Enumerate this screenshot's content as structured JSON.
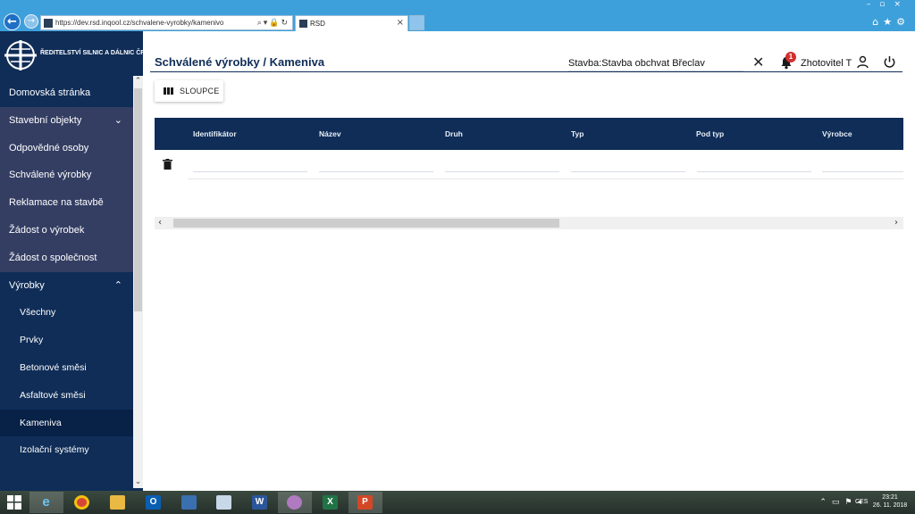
{
  "browser": {
    "url": "https://dev.rsd.inqool.cz/schvalene-vyrobky/kamenivo",
    "tab_title": "RSD"
  },
  "sidebar": {
    "logo_text": "ŘEDITELSTVÍ SILNIC A DÁLNIC ČR",
    "items": [
      {
        "label": "Domovská stránka"
      },
      {
        "label": "Stavební objekty",
        "chevron": "chevron-down-icon"
      },
      {
        "label": "Odpovědné osoby"
      },
      {
        "label": "Schválené výrobky"
      },
      {
        "label": "Reklamace na stavbě"
      },
      {
        "label": "Žádost o výrobek"
      },
      {
        "label": "Žádost o společnost"
      },
      {
        "label": "Výrobky",
        "chevron": "chevron-up-icon"
      },
      {
        "label": "Všechny"
      },
      {
        "label": "Prvky"
      },
      {
        "label": "Betonové směsi"
      },
      {
        "label": "Asfaltové směsi"
      },
      {
        "label": "Kameniva",
        "active": true
      },
      {
        "label": "Izolační systémy"
      }
    ]
  },
  "header": {
    "title": "Schválené výrobky / Kameniva",
    "stavba": "Stavba:Stavba obchvat Břeclav",
    "notification_count": "1",
    "user": "Zhotovitel T"
  },
  "toolbar": {
    "columns_label": "SLOUPCE"
  },
  "table": {
    "columns": [
      "Identifikátor",
      "Název",
      "Druh",
      "Typ",
      "Pod typ",
      "Výrobce"
    ]
  },
  "taskbar": {
    "apps": [
      "internet-explorer",
      "chrome",
      "file-explorer",
      "outlook",
      "network-app",
      "notepad",
      "word",
      "paint",
      "excel",
      "powerpoint"
    ],
    "language": "CES",
    "time": "23:21",
    "date": "26. 11. 2018"
  },
  "colors": {
    "navy": "#0f2d57",
    "sidebar_highlight": "#343e63",
    "browser_blue": "#3ea0db",
    "badge_red": "#d32f2f"
  }
}
